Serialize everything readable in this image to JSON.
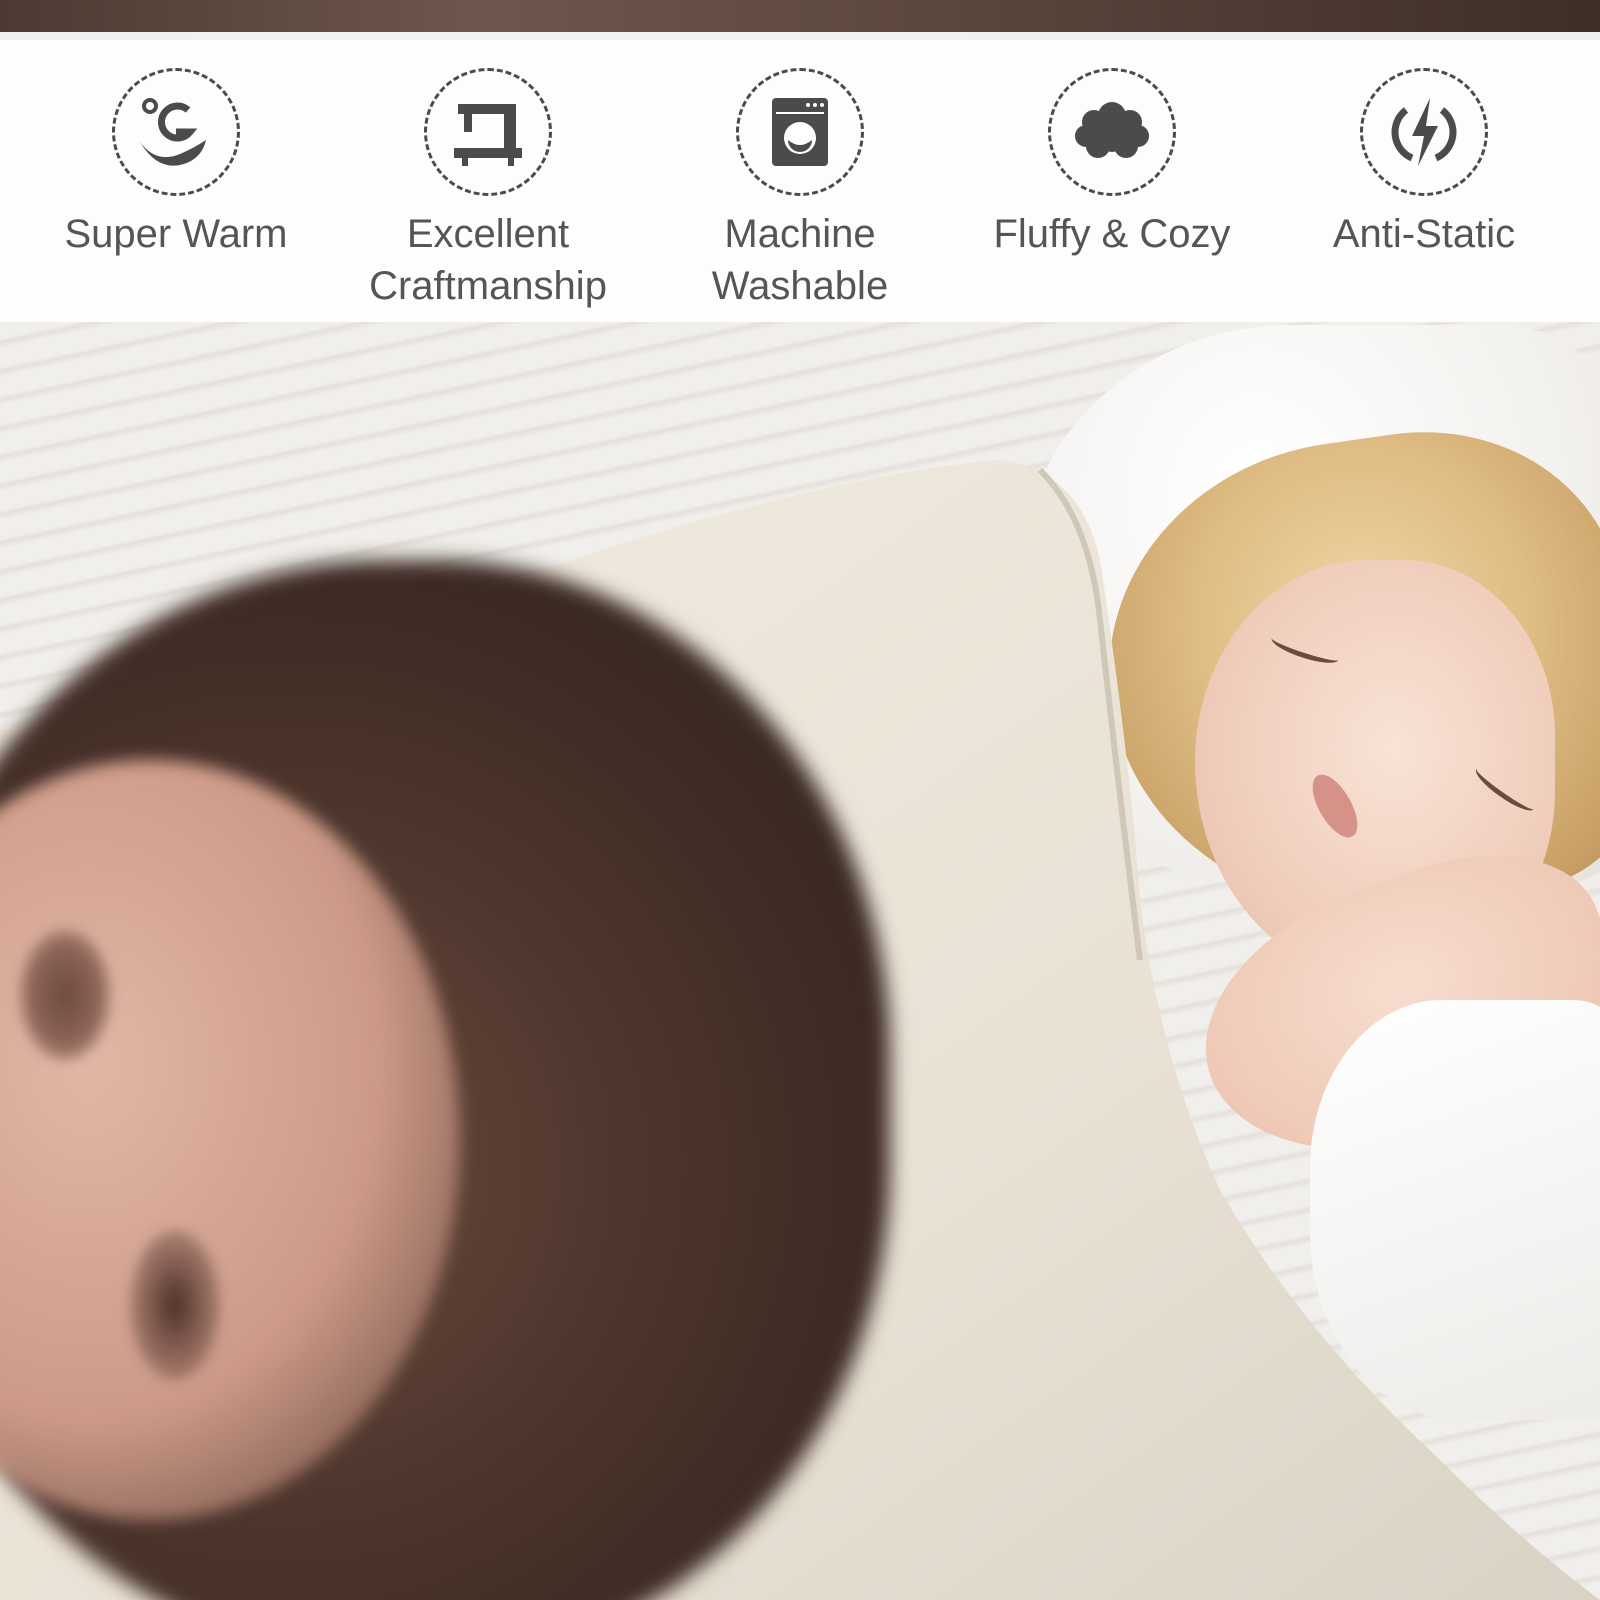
{
  "banner": {
    "background": "#ffffff",
    "icon_color": "#4b4b4b",
    "text_color": "#555555",
    "features": [
      {
        "icon": "temperature-wave-icon",
        "label": "Super Warm"
      },
      {
        "icon": "sewing-machine-icon",
        "label": "Excellent\nCraftmanship"
      },
      {
        "icon": "washing-machine-icon",
        "label": "Machine\nWashable"
      },
      {
        "icon": "cloud-icon",
        "label": "Fluffy & Cozy"
      },
      {
        "icon": "lightning-bolt-icon",
        "label": "Anti-Static"
      }
    ]
  },
  "photo": {
    "subject": "woman sleeping under blanket printed with bearded face"
  }
}
